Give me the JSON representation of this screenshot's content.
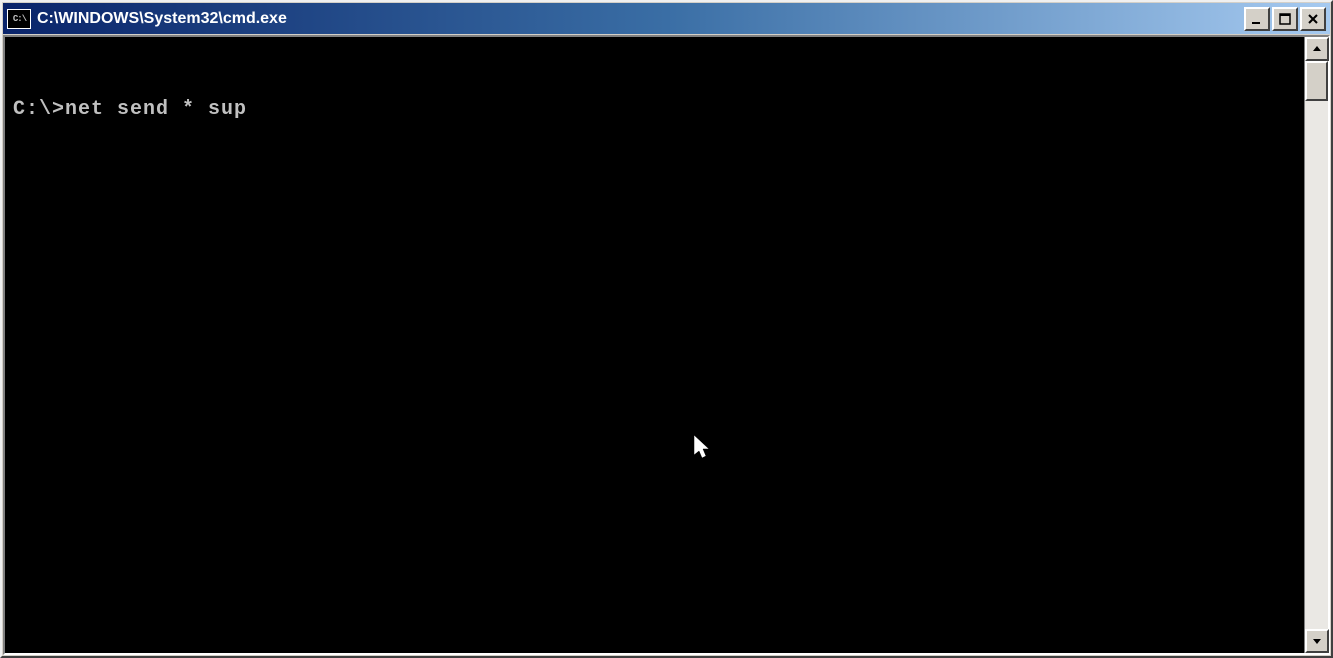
{
  "window": {
    "title": "C:\\WINDOWS\\System32\\cmd.exe",
    "icon_label": "C:\\"
  },
  "console": {
    "prompt": "C:\\>",
    "command": "net send * sup"
  }
}
